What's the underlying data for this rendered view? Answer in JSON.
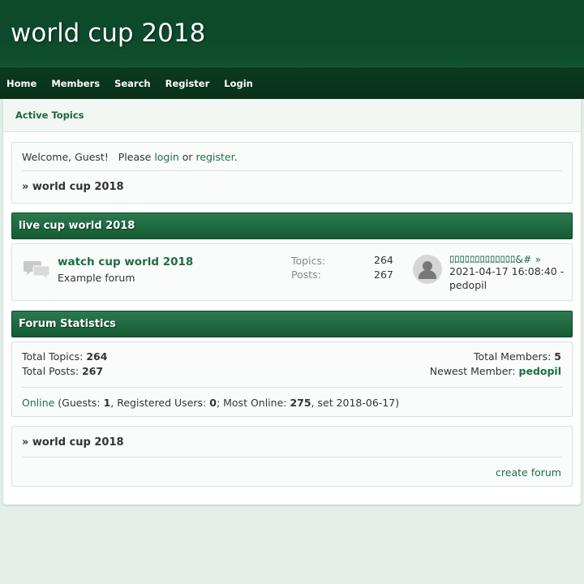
{
  "site": {
    "title": "world cup 2018"
  },
  "nav": {
    "items": [
      "Home",
      "Members",
      "Search",
      "Register",
      "Login"
    ]
  },
  "subnav": {
    "active_topics": "Active Topics"
  },
  "welcome": {
    "prefix": "Welcome, Guest!   Please ",
    "login": "login",
    "or": " or ",
    "register": "register",
    "suffix": ".",
    "breadcrumb": "» world cup 2018"
  },
  "category": {
    "title": "live cup world 2018",
    "forum": {
      "title": "watch cup world 2018",
      "description": "Example forum",
      "topics_label": "Topics:",
      "topics": "264",
      "posts_label": "Posts:",
      "posts": "267",
      "last_post_title": "ﾛﾛﾛﾛﾛﾛﾛﾛﾛﾛﾛﾛﾛ&# »",
      "last_post_date": "2021-04-17 16:08:40 -",
      "last_post_user": "pedopil",
      "icon": "forum-bubbles-icon",
      "avatar_icon": "user-avatar-icon"
    }
  },
  "stats": {
    "header": "Forum Statistics",
    "total_topics_label": "Total Topics:",
    "total_topics": "264",
    "total_posts_label": "Total Posts:",
    "total_posts": "267",
    "total_members_label": "Total Members:",
    "total_members": "5",
    "newest_member_label": "Newest Member:",
    "newest_member": "pedopil",
    "online_link": "Online",
    "guests_label": " (Guests: ",
    "guests": "1",
    "registered_label": ", Registered Users: ",
    "registered": "0",
    "most_online_label": "; Most Online: ",
    "most_online": "275",
    "most_online_date": ", set 2018-06-17)"
  },
  "footer": {
    "breadcrumb": "» world cup 2018",
    "create_forum": "create forum"
  },
  "colors": {
    "header": "#0d4a2b",
    "nav": "#0a361e",
    "accent": "#1e6e42",
    "bg": "#e3eee8"
  }
}
